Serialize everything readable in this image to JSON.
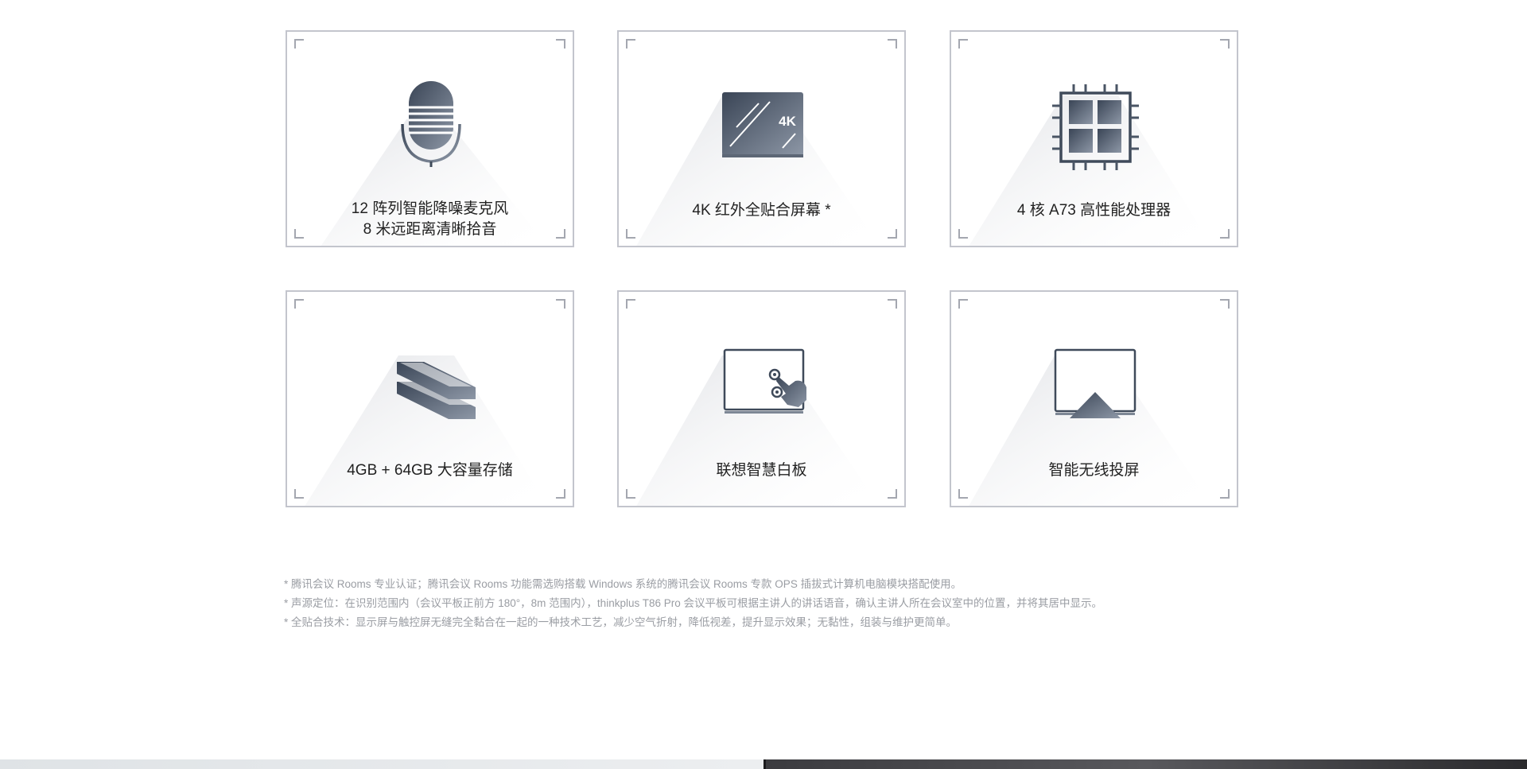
{
  "features": [
    {
      "icon": "microphone-icon",
      "line1": "12 阵列智能降噪麦克风",
      "line2": "8 米远距离清晰拾音"
    },
    {
      "icon": "4k-screen-icon",
      "line1": "4K 红外全贴合屏幕 *",
      "line2": "",
      "screen_badge": "4K"
    },
    {
      "icon": "processor-chip-icon",
      "line1": "4 核 A73 高性能处理器",
      "line2": ""
    },
    {
      "icon": "storage-icon",
      "line1": "4GB + 64GB 大容量存储",
      "line2": ""
    },
    {
      "icon": "whiteboard-touch-icon",
      "line1": "联想智慧白板",
      "line2": ""
    },
    {
      "icon": "wireless-projection-icon",
      "line1": "智能无线投屏",
      "line2": ""
    }
  ],
  "footnotes": [
    "* 腾讯会议 Rooms 专业认证；腾讯会议 Rooms 功能需选购搭载 Windows 系统的腾讯会议 Rooms 专款 OPS 插拔式计算机电脑模块搭配使用。",
    "* 声源定位：在识别范围内（会议平板正前方 180°，8m 范围内），thinkplus T86 Pro 会议平板可根据主讲人的讲话语音，确认主讲人所在会议室中的位置，并将其居中显示。",
    "* 全贴合技术：显示屏与触控屏无缝完全黏合在一起的一种技术工艺，减少空气折射，降低视差，提升显示效果；无黏性，组装与维护更简单。"
  ],
  "colors": {
    "icon_dark": "#3f4a5a",
    "icon_light": "#8a94a3",
    "card_border": "#c3c5cd",
    "caption_text": "#222222",
    "note_text": "#9a9da3"
  }
}
